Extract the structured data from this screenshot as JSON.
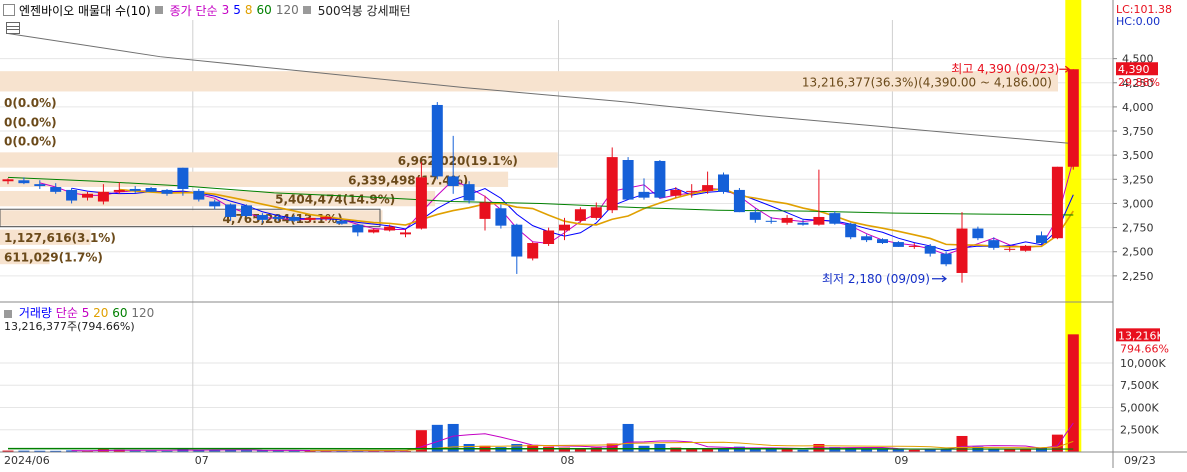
{
  "header": {
    "stock_label": "엔젠바이오 매물대 수(10)",
    "ma_label": "종가 단순",
    "ma_periods": [
      "3",
      "5",
      "8",
      "60",
      "120"
    ],
    "ma_colors": [
      "#c400c4",
      "#0000ff",
      "#e0a000",
      "#008000",
      "#707070"
    ],
    "pattern_label": "500억봉 강세패턴"
  },
  "right_labels": {
    "lc": "LC:101.38",
    "hc": "HC:0.00",
    "last_price_badge": "4,390",
    "last_change_pct": "29.88%",
    "vol_badge": "13,216K",
    "vol_pct": "794.66%"
  },
  "annotations": {
    "high_label": "최고 4,390 (09/23)",
    "low_label": "최저 2,180 (09/09)",
    "top_profile": "13,216,377(36.3%)(4,390.00 ~ 4,186.00)"
  },
  "volume_legend": {
    "label": "거래량",
    "ma_label": "단순",
    "periods": [
      "5",
      "20",
      "60",
      "120"
    ],
    "colors": [
      "#c400c4",
      "#e0a000",
      "#008000",
      "#707070"
    ],
    "current": "13,216,377주(794.66%)"
  },
  "chart_data": {
    "type": "candlestick",
    "price_axis": {
      "ticks": [
        "4,500",
        "4,250",
        "4,000",
        "3,750",
        "3,500",
        "3,250",
        "3,000",
        "2,750",
        "2,500",
        "2,250"
      ],
      "ylim": [
        2000,
        4900
      ]
    },
    "volume_axis": {
      "ticks": [
        "10,000K",
        "7,500K",
        "5,000K",
        "2,500K"
      ],
      "ylim": [
        0,
        15500
      ]
    },
    "x_labels": [
      {
        "text": "2024/06",
        "index": 0
      },
      {
        "text": "07",
        "index": 12
      },
      {
        "text": "08",
        "index": 35
      },
      {
        "text": "09",
        "index": 56
      },
      {
        "text": "09/23",
        "index": 67
      }
    ],
    "candles": [
      {
        "o": 3230,
        "h": 3260,
        "l": 3200,
        "c": 3250,
        "v": 160
      },
      {
        "o": 3240,
        "h": 3270,
        "l": 3200,
        "c": 3210,
        "v": 150
      },
      {
        "o": 3200,
        "h": 3240,
        "l": 3150,
        "c": 3180,
        "v": 140
      },
      {
        "o": 3170,
        "h": 3210,
        "l": 3100,
        "c": 3120,
        "v": 130
      },
      {
        "o": 3140,
        "h": 3160,
        "l": 3000,
        "c": 3030,
        "v": 180
      },
      {
        "o": 3060,
        "h": 3120,
        "l": 3030,
        "c": 3100,
        "v": 120
      },
      {
        "o": 3020,
        "h": 3200,
        "l": 2990,
        "c": 3120,
        "v": 300
      },
      {
        "o": 3120,
        "h": 3220,
        "l": 3100,
        "c": 3140,
        "v": 250
      },
      {
        "o": 3150,
        "h": 3180,
        "l": 3110,
        "c": 3130,
        "v": 150
      },
      {
        "o": 3160,
        "h": 3170,
        "l": 3120,
        "c": 3120,
        "v": 140
      },
      {
        "o": 3140,
        "h": 3150,
        "l": 3080,
        "c": 3100,
        "v": 130
      },
      {
        "o": 3370,
        "h": 3370,
        "l": 3080,
        "c": 3150,
        "v": 450
      },
      {
        "o": 3130,
        "h": 3150,
        "l": 3020,
        "c": 3040,
        "v": 200
      },
      {
        "o": 3020,
        "h": 3040,
        "l": 2940,
        "c": 2970,
        "v": 180
      },
      {
        "o": 2990,
        "h": 3000,
        "l": 2820,
        "c": 2860,
        "v": 220
      },
      {
        "o": 2980,
        "h": 2990,
        "l": 2860,
        "c": 2870,
        "v": 200
      },
      {
        "o": 2880,
        "h": 2900,
        "l": 2800,
        "c": 2830,
        "v": 170
      },
      {
        "o": 2860,
        "h": 2890,
        "l": 2820,
        "c": 2840,
        "v": 160
      },
      {
        "o": 2860,
        "h": 2880,
        "l": 2810,
        "c": 2820,
        "v": 150
      },
      {
        "o": 2830,
        "h": 2860,
        "l": 2810,
        "c": 2850,
        "v": 130
      },
      {
        "o": 2840,
        "h": 2870,
        "l": 2820,
        "c": 2860,
        "v": 120
      },
      {
        "o": 2820,
        "h": 2830,
        "l": 2780,
        "c": 2790,
        "v": 140
      },
      {
        "o": 2780,
        "h": 2790,
        "l": 2660,
        "c": 2700,
        "v": 160
      },
      {
        "o": 2700,
        "h": 2740,
        "l": 2690,
        "c": 2730,
        "v": 120
      },
      {
        "o": 2720,
        "h": 2780,
        "l": 2710,
        "c": 2760,
        "v": 130
      },
      {
        "o": 2680,
        "h": 2730,
        "l": 2650,
        "c": 2700,
        "v": 110
      },
      {
        "o": 2740,
        "h": 3430,
        "l": 2730,
        "c": 3270,
        "v": 2450
      },
      {
        "o": 4020,
        "h": 4050,
        "l": 3250,
        "c": 3280,
        "v": 3050
      },
      {
        "o": 3280,
        "h": 3700,
        "l": 3100,
        "c": 3180,
        "v": 3150
      },
      {
        "o": 3200,
        "h": 3230,
        "l": 3000,
        "c": 3030,
        "v": 900
      },
      {
        "o": 2840,
        "h": 3080,
        "l": 2720,
        "c": 3010,
        "v": 700
      },
      {
        "o": 2950,
        "h": 2990,
        "l": 2740,
        "c": 2770,
        "v": 550
      },
      {
        "o": 2780,
        "h": 2790,
        "l": 2270,
        "c": 2450,
        "v": 900
      },
      {
        "o": 2430,
        "h": 2600,
        "l": 2410,
        "c": 2590,
        "v": 800
      },
      {
        "o": 2580,
        "h": 2750,
        "l": 2560,
        "c": 2720,
        "v": 600
      },
      {
        "o": 2720,
        "h": 2850,
        "l": 2620,
        "c": 2780,
        "v": 500
      },
      {
        "o": 2820,
        "h": 2960,
        "l": 2800,
        "c": 2940,
        "v": 400
      },
      {
        "o": 2850,
        "h": 3010,
        "l": 2830,
        "c": 2960,
        "v": 500
      },
      {
        "o": 2930,
        "h": 3580,
        "l": 2900,
        "c": 3480,
        "v": 950
      },
      {
        "o": 3450,
        "h": 3480,
        "l": 3040,
        "c": 3040,
        "v": 3150
      },
      {
        "o": 3120,
        "h": 3260,
        "l": 3040,
        "c": 3060,
        "v": 700
      },
      {
        "o": 3440,
        "h": 3450,
        "l": 3050,
        "c": 3060,
        "v": 900
      },
      {
        "o": 3080,
        "h": 3170,
        "l": 3060,
        "c": 3140,
        "v": 500
      },
      {
        "o": 3120,
        "h": 3200,
        "l": 3060,
        "c": 3130,
        "v": 400
      },
      {
        "o": 3130,
        "h": 3330,
        "l": 3100,
        "c": 3190,
        "v": 450
      },
      {
        "o": 3300,
        "h": 3320,
        "l": 3100,
        "c": 3120,
        "v": 400
      },
      {
        "o": 3140,
        "h": 3160,
        "l": 2910,
        "c": 2910,
        "v": 600
      },
      {
        "o": 2910,
        "h": 2950,
        "l": 2800,
        "c": 2830,
        "v": 500
      },
      {
        "o": 2820,
        "h": 2860,
        "l": 2790,
        "c": 2810,
        "v": 350
      },
      {
        "o": 2800,
        "h": 2880,
        "l": 2780,
        "c": 2850,
        "v": 300
      },
      {
        "o": 2800,
        "h": 2840,
        "l": 2770,
        "c": 2780,
        "v": 250
      },
      {
        "o": 2780,
        "h": 3350,
        "l": 2770,
        "c": 2860,
        "v": 900
      },
      {
        "o": 2900,
        "h": 2920,
        "l": 2780,
        "c": 2790,
        "v": 550
      },
      {
        "o": 2790,
        "h": 2800,
        "l": 2630,
        "c": 2650,
        "v": 450
      },
      {
        "o": 2660,
        "h": 2680,
        "l": 2600,
        "c": 2620,
        "v": 350
      },
      {
        "o": 2630,
        "h": 2640,
        "l": 2580,
        "c": 2590,
        "v": 300
      },
      {
        "o": 2600,
        "h": 2610,
        "l": 2550,
        "c": 2550,
        "v": 280
      },
      {
        "o": 2560,
        "h": 2590,
        "l": 2530,
        "c": 2560,
        "v": 250
      },
      {
        "o": 2560,
        "h": 2580,
        "l": 2450,
        "c": 2480,
        "v": 350
      },
      {
        "o": 2480,
        "h": 2500,
        "l": 2350,
        "c": 2370,
        "v": 400
      },
      {
        "o": 2280,
        "h": 2910,
        "l": 2180,
        "c": 2740,
        "v": 1800
      },
      {
        "o": 2740,
        "h": 2760,
        "l": 2620,
        "c": 2640,
        "v": 600
      },
      {
        "o": 2620,
        "h": 2650,
        "l": 2520,
        "c": 2540,
        "v": 400
      },
      {
        "o": 2520,
        "h": 2550,
        "l": 2500,
        "c": 2530,
        "v": 300
      },
      {
        "o": 2510,
        "h": 2570,
        "l": 2500,
        "c": 2560,
        "v": 300
      },
      {
        "o": 2670,
        "h": 2710,
        "l": 2580,
        "c": 2590,
        "v": 500
      },
      {
        "o": 2640,
        "h": 3380,
        "l": 2630,
        "c": 3380,
        "v": 1950
      },
      {
        "o": 3380,
        "h": 4390,
        "l": 3350,
        "c": 4390,
        "v": 13216
      }
    ],
    "volume_profile": [
      {
        "label": "0(0.0%)",
        "price_low": 3950,
        "price_high": 4150,
        "pct": 0
      },
      {
        "label": "0(0.0%)",
        "price_low": 3750,
        "price_high": 3950,
        "pct": 0
      },
      {
        "label": "0(0.0%)",
        "price_low": 3550,
        "price_high": 3750,
        "pct": 0
      },
      {
        "label": "6,962,020(19.1%)",
        "price_low": 3350,
        "price_high": 3550,
        "pct": 19.1
      },
      {
        "label": "6,339,498(17.4%)",
        "price_low": 3150,
        "price_high": 3350,
        "pct": 17.4
      },
      {
        "label": "5,404,474(14.9%)",
        "price_low": 2950,
        "price_high": 3150,
        "pct": 14.9
      },
      {
        "label": "4,765,284(13.1%)",
        "price_low": 2750,
        "price_high": 2950,
        "pct": 13.1
      },
      {
        "label": "1,127,616(3.1%)",
        "price_low": 2550,
        "price_high": 2750,
        "pct": 3.1
      },
      {
        "label": "611,029(1.7%)",
        "price_low": 2350,
        "price_high": 2550,
        "pct": 1.7
      }
    ],
    "ma60_trace": [
      3270,
      3230,
      3180,
      3110,
      3070,
      3020,
      3000,
      2960,
      2930,
      2920,
      2900,
      2890,
      2880
    ],
    "ma120_trace": [
      4760,
      4520,
      4360,
      4200,
      4060,
      3900,
      3760,
      3620
    ],
    "grid": true
  }
}
